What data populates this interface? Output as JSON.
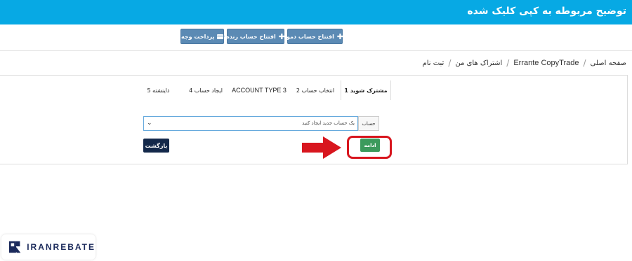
{
  "banner": {
    "title": "توضیح مربوطه به کپی کلیک شده"
  },
  "toolbar": {
    "demo_account": "افتتاح حساب دمو",
    "live_account": "افتتاح حساب زنده",
    "deposit": "پرداخت وجه",
    "demo_icon": "plus-icon",
    "live_icon": "plus-icon",
    "deposit_icon": "credit-card-icon"
  },
  "breadcrumb": {
    "items": [
      "صفحه اصلی",
      "Errante CopyTrade",
      "اشتراک های من",
      "ثبت نام"
    ]
  },
  "steps": [
    {
      "label": "مشترک شوید 1",
      "active": true
    },
    {
      "label": "انتخاب حساب 2",
      "active": false
    },
    {
      "label": "3 ACCOUNT TYPE",
      "active": false
    },
    {
      "label": "ایجاد حساب 4",
      "active": false
    },
    {
      "label": "ذاینشته 5",
      "active": false
    }
  ],
  "form": {
    "account_label": "حساب",
    "account_select_value": "یک حساب جدید ایجاد کنید",
    "continue_button": "ادامه",
    "back_button": "بازگشت"
  },
  "annotation": {
    "highlight_color": "#d8161e",
    "arrow_color": "#d8161e"
  },
  "logo": {
    "text": "IRANREBATE"
  },
  "colors": {
    "banner": "#07a9e4",
    "toolbar_button": "#5b8ab4",
    "continue": "#3c9a5c",
    "back": "#13284a"
  }
}
